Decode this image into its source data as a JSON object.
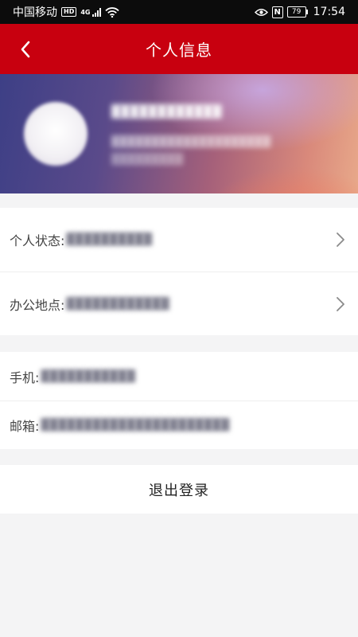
{
  "status_bar": {
    "carrier": "中国移动",
    "hd_badge": "HD",
    "network": "4G",
    "battery_level": "79",
    "nfc": "N",
    "time": "17:54"
  },
  "nav": {
    "title": "个人信息"
  },
  "profile": {
    "name_blurred": "████████████",
    "detail_blurred": "████████████████████",
    "detail2_blurred": "█████████"
  },
  "info_section": {
    "status_label": "个人状态:",
    "status_value": "██████████",
    "office_label": "办公地点:",
    "office_value": "████████████"
  },
  "contact_section": {
    "phone_label": "手机:",
    "phone_value": "███████████",
    "email_label": "邮箱:",
    "email_value": "██████████████████████"
  },
  "actions": {
    "logout_label": "退出登录"
  },
  "colors": {
    "nav_red": "#c8000f",
    "page_bg": "#f4f4f5"
  }
}
